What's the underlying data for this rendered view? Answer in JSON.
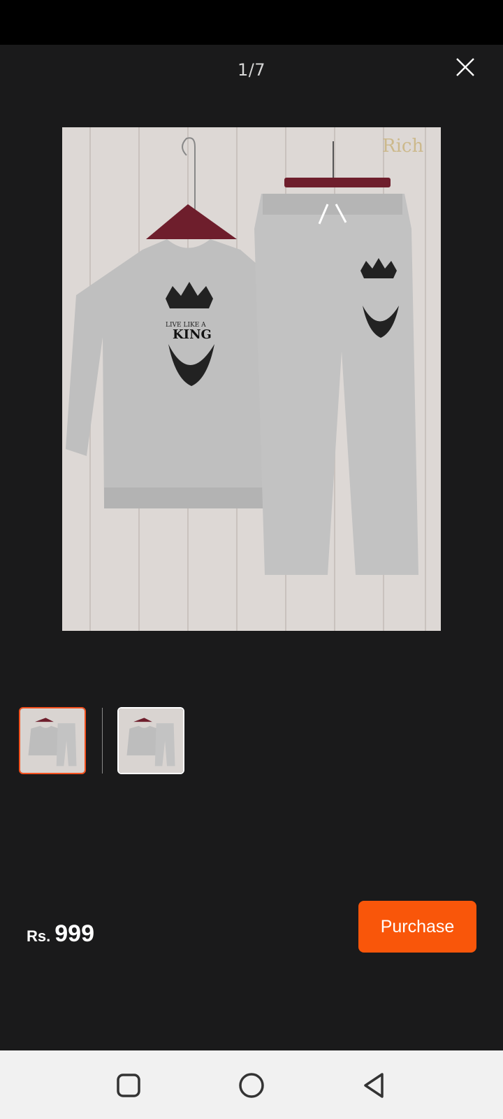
{
  "viewer": {
    "counter": "1/7",
    "main_image_icon": "product-photo",
    "watermark_text": "Rich",
    "print_text": "LIVE LIKE A",
    "print_title": "KING",
    "thumbnails": [
      {
        "name": "thumbnail-1",
        "selected": true
      },
      {
        "name": "thumbnail-2",
        "selected": false
      }
    ]
  },
  "footer": {
    "currency": "Rs.",
    "price": "999",
    "purchase_label": "Purchase"
  },
  "navbar": {
    "icons": [
      "recent-apps-icon",
      "home-icon",
      "back-icon"
    ]
  },
  "colors": {
    "accent": "#f9560a",
    "background": "#1a1a1b",
    "nav_background": "#f1f1f1"
  }
}
